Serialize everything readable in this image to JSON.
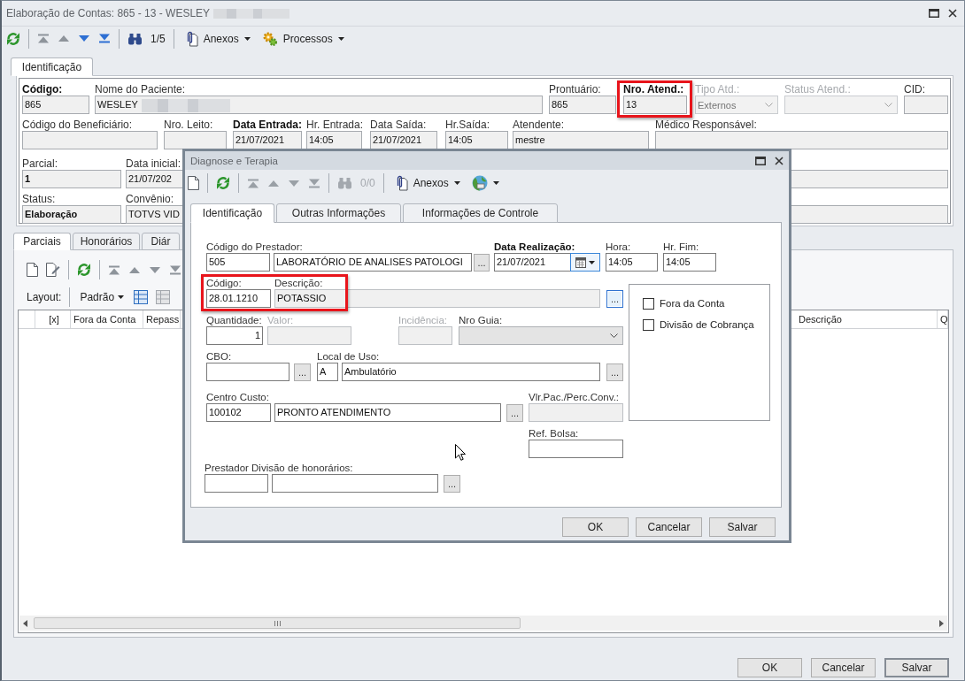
{
  "window": {
    "title": "Elaboração de Contas: 865 - 13 - WESLEY",
    "redacted": true
  },
  "toolbar": {
    "counter": "1/5",
    "menus": [
      "Anexos",
      "Processos"
    ]
  },
  "tabs": [
    {
      "label": "Identificação",
      "selected": true
    }
  ],
  "header": {
    "lines": [
      {
        "fields": [
          {
            "kind": "text",
            "label": "Código:",
            "bold": true,
            "value": "865"
          },
          {
            "kind": "text",
            "label": "Nome do Paciente:",
            "value": "WESLEY",
            "redacted": true
          },
          {
            "kind": "text",
            "label": "Prontuário:",
            "value": "865"
          },
          {
            "kind": "text",
            "label": "Nro. Atend.:",
            "bold": true,
            "value": "13",
            "highlighted": true
          },
          {
            "kind": "combo",
            "label": "Tipo Atd.:",
            "value": "Externos",
            "disabled": true
          },
          {
            "kind": "combo",
            "label": "Status Atend.:",
            "disabled": true
          },
          {
            "kind": "text",
            "label": "CID:"
          }
        ]
      },
      {
        "fields": [
          {
            "kind": "text",
            "label": "Código do Beneficiário:"
          },
          {
            "kind": "text",
            "label": "Nro. Leito:"
          },
          {
            "kind": "text",
            "label": "Data Entrada:",
            "bold": true,
            "value": "21/07/2021"
          },
          {
            "kind": "text",
            "label": "Hr. Entrada:",
            "value": "14:05"
          },
          {
            "kind": "text",
            "label": "Data Saída:",
            "value": "21/07/2021"
          },
          {
            "kind": "text",
            "label": "Hr.Saída:",
            "value": "14:05"
          },
          {
            "kind": "text",
            "label": "Atendente:",
            "value": "mestre"
          },
          {
            "kind": "text",
            "label": "Médico Responsável:"
          }
        ]
      },
      {
        "fields": [
          {
            "kind": "text",
            "label": "Parcial:",
            "value": "1",
            "value_bold": true
          },
          {
            "kind": "text",
            "label": "Data inicial:",
            "value": "21/07/202"
          },
          {
            "kind": "text"
          }
        ]
      },
      {
        "fields": [
          {
            "kind": "text",
            "label": "Status:",
            "value": "Elaboração",
            "value_bold": true
          },
          {
            "kind": "text",
            "label": "Convênio:",
            "value": "TOTVS VID"
          },
          {
            "kind": "text"
          }
        ]
      }
    ]
  },
  "lower_tabs": [
    {
      "label": "Parciais",
      "selected": true
    },
    {
      "label": "Honorários",
      "selected": false
    },
    {
      "label": "Diár",
      "selected": false
    }
  ],
  "grid_toolbar": {
    "layout_label": "Layout:",
    "layout_value": "Padrão"
  },
  "grid": {
    "columns": [
      {
        "label": "[x]"
      },
      {
        "label": "Fora da Conta"
      },
      {
        "label": "Repass"
      },
      {
        "label": "Descrição"
      },
      {
        "label": "Q"
      }
    ]
  },
  "buttons": [
    {
      "label": "OK",
      "default": false
    },
    {
      "label": "Cancelar",
      "default": false
    },
    {
      "label": "Salvar",
      "default": true
    }
  ],
  "dialog": {
    "title": "Diagnose e Terapia",
    "toolbar": {
      "counter": "0/0",
      "menus": [
        "Anexos"
      ]
    },
    "tabs": [
      {
        "label": "Identificação",
        "selected": true
      },
      {
        "label": "Outras Informações",
        "selected": false
      },
      {
        "label": "Informações de Controle",
        "selected": false
      }
    ],
    "lines": [
      {
        "fields": [
          {
            "kind": "text",
            "label": "Código do Prestador:",
            "value": "505"
          },
          {
            "kind": "text",
            "value": "LABORATÓRIO DE ANALISES PATOLOGI"
          },
          {
            "kind": "lookup",
            "text": "..."
          },
          {
            "kind": "date",
            "label": "Data Realização:",
            "bold": true,
            "value": "21/07/2021"
          },
          {
            "kind": "text",
            "label": "Hora:",
            "value": "14:05"
          },
          {
            "kind": "text",
            "label": "Hr. Fim:",
            "value": "14:05"
          }
        ]
      },
      {
        "fields": [
          {
            "kind": "text",
            "label": "Código:",
            "value": "28.01.1210",
            "highlighted": true
          },
          {
            "kind": "text",
            "label": "Descrição:",
            "value": "POTASSIO",
            "readonly": true
          },
          {
            "kind": "lookup",
            "text": "...",
            "focused": true
          }
        ]
      },
      {
        "fields": [
          {
            "kind": "number",
            "label": "Quantidade:",
            "value": "1"
          },
          {
            "kind": "text",
            "label": "Valor:",
            "disabled": true
          },
          {
            "kind": "text",
            "label": "Incidência:",
            "disabled": true
          },
          {
            "kind": "combo",
            "label": "Nro Guia:",
            "readonly": true
          }
        ]
      },
      {
        "fields": [
          {
            "kind": "text",
            "label": "CBO:"
          },
          {
            "kind": "lookup",
            "text": "..."
          },
          {
            "kind": "text",
            "label": "Local de Uso:",
            "value": "A"
          },
          {
            "kind": "text",
            "value": "Ambulatório"
          },
          {
            "kind": "lookup",
            "text": "..."
          }
        ]
      },
      {
        "fields": [
          {
            "kind": "text",
            "label": "Centro Custo:",
            "value": "100102"
          },
          {
            "kind": "text",
            "value": "PRONTO ATENDIMENTO"
          },
          {
            "kind": "lookup",
            "text": "..."
          },
          {
            "kind": "text",
            "label": "Vlr.Pac./Perc.Conv.:",
            "readonly": true
          }
        ]
      },
      {
        "fields": [
          {
            "kind": "text",
            "label": "Ref. Bolsa:"
          }
        ]
      },
      {
        "fields": [
          {
            "kind": "text",
            "label": "Prestador Divisão de honorários:"
          },
          {
            "kind": "text"
          },
          {
            "kind": "lookup",
            "text": "..."
          }
        ]
      }
    ],
    "options": [
      {
        "label": "Fora da Conta",
        "checked": false
      },
      {
        "label": "Divisão de Cobrança",
        "checked": false
      }
    ],
    "buttons": [
      "OK",
      "Cancelar",
      "Salvar"
    ]
  }
}
